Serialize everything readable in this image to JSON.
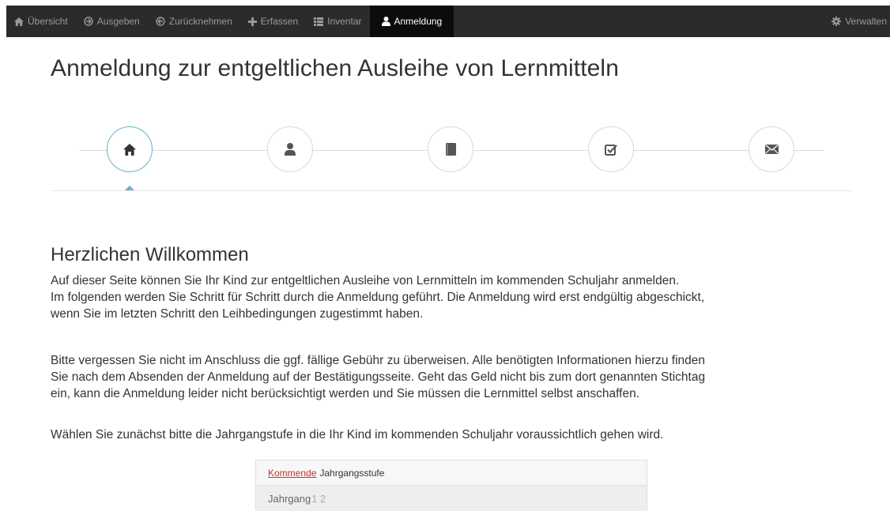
{
  "nav": {
    "items": [
      {
        "label": "Übersicht",
        "icon": "home-icon"
      },
      {
        "label": "Ausgeben",
        "icon": "arrow-circle-icon"
      },
      {
        "label": "Zurücknehmen",
        "icon": "arrow-circle-icon"
      },
      {
        "label": "Erfassen",
        "icon": "plus-icon"
      },
      {
        "label": "Inventar",
        "icon": "list-icon"
      },
      {
        "label": "Anmeldung",
        "icon": "user-icon"
      }
    ],
    "admin": {
      "label": "Verwalten",
      "icon": "gear-icon"
    }
  },
  "page": {
    "title": "Anmeldung zur entgeltlichen Ausleihe von Lernmitteln"
  },
  "steps": [
    {
      "icon": "home-icon"
    },
    {
      "icon": "user-icon"
    },
    {
      "icon": "book-icon"
    },
    {
      "icon": "checkbox-icon"
    },
    {
      "icon": "envelope-icon"
    }
  ],
  "welcome": {
    "title": "Herzlichen Willkommen",
    "p1_line1": "Auf dieser Seite können Sie Ihr Kind zur entgeltlichen Ausleihe von Lernmitteln im kommenden Schuljahr anmelden.",
    "p1_line2": "Im folgenden werden Sie Schritt für Schritt durch die Anmeldung geführt. Die Anmeldung wird erst endgültig abgeschickt,",
    "p1_line3": "wenn Sie im letzten Schritt den Leihbedingungen zugestimmt haben.",
    "p2_line1": "Bitte vergessen Sie nicht im Anschluss die ggf. fällige Gebühr zu überweisen. Alle benötigten Informationen hierzu finden",
    "p2_line2": "Sie nach dem Absenden der Anmeldung auf der Bestätigungsseite. Geht das Geld nicht bis zum dort genannten Stichtag",
    "p2_line3": "ein, kann die Anmeldung leider nicht berücksichtigt werden und Sie müssen die Lernmittel selbst anschaffen.",
    "p3": "Wählen Sie zunächst bitte die Jahrgangstufe in die Ihr Kind im kommenden Schuljahr voraussichtlich gehen wird."
  },
  "grade_select": {
    "heading_keyword": "Kommende",
    "heading_rest": "Jahrgangsstufe",
    "row_label": "Jahrgang",
    "row_value": "1 2"
  },
  "colors": {
    "navbar": "#2b2b2b",
    "nav_active": "#0c0c0c",
    "step_active": "#6ab0c8",
    "link_red": "#c9302c"
  }
}
